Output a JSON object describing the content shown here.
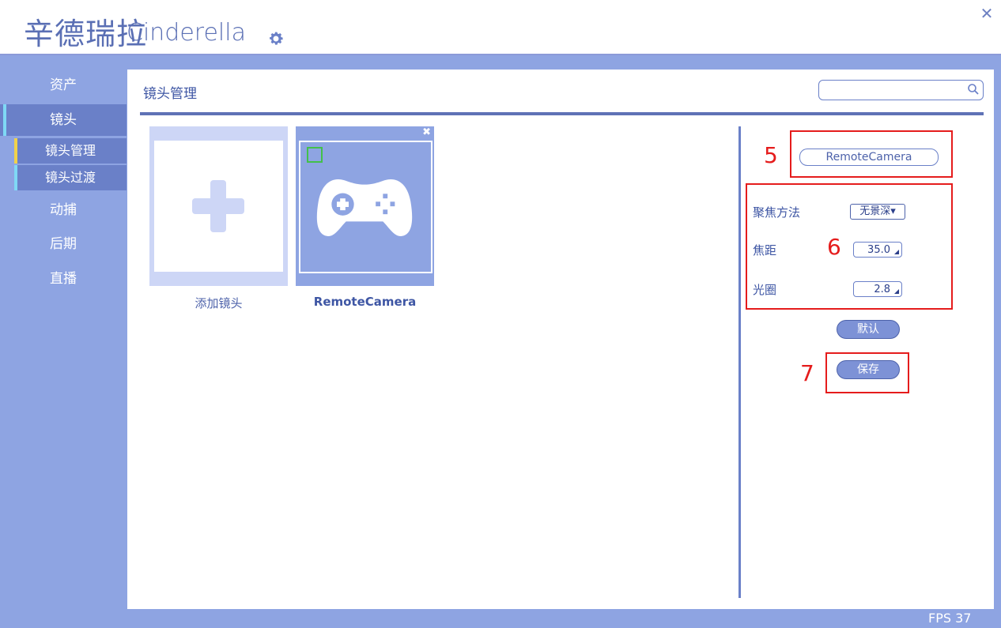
{
  "app": {
    "title_cn": "辛德瑞拉",
    "title_en": "Cinderella",
    "icons": {
      "settings": "gear-icon",
      "close": "close-icon",
      "search": "search-icon"
    }
  },
  "sidebar": {
    "items": [
      {
        "label": "资产"
      },
      {
        "label": "镜头",
        "active": true
      },
      {
        "label": "动捕"
      },
      {
        "label": "后期"
      },
      {
        "label": "直播"
      }
    ],
    "subitems": [
      {
        "label": "镜头管理",
        "bar_color": "#f0d24a"
      },
      {
        "label": "镜头过渡",
        "bar_color": "#7fd8f5"
      }
    ]
  },
  "main": {
    "title": "镜头管理",
    "search": {
      "value": "",
      "placeholder": ""
    },
    "cards": [
      {
        "label": "添加镜头",
        "icon": "plus-icon"
      },
      {
        "label": "RemoteCamera",
        "icon": "gamepad-icon",
        "selected": true
      }
    ]
  },
  "panel": {
    "camera_name": "RemoteCamera",
    "focus_method_label": "聚焦方法",
    "focus_method_value": "无景深▾",
    "focal_length_label": "焦距",
    "focal_length_value": "35.0",
    "aperture_label": "光圈",
    "aperture_value": "2.8",
    "default_button": "默认",
    "save_button": "保存",
    "callouts": {
      "name": "5",
      "params": "6",
      "save": "7"
    }
  },
  "status": {
    "fps": "FPS 37"
  },
  "colors": {
    "accent": "#8ea4e2",
    "sidebar_active": "#6a80c8",
    "annotation": "#e51c1c",
    "text": "#3e56a4"
  }
}
